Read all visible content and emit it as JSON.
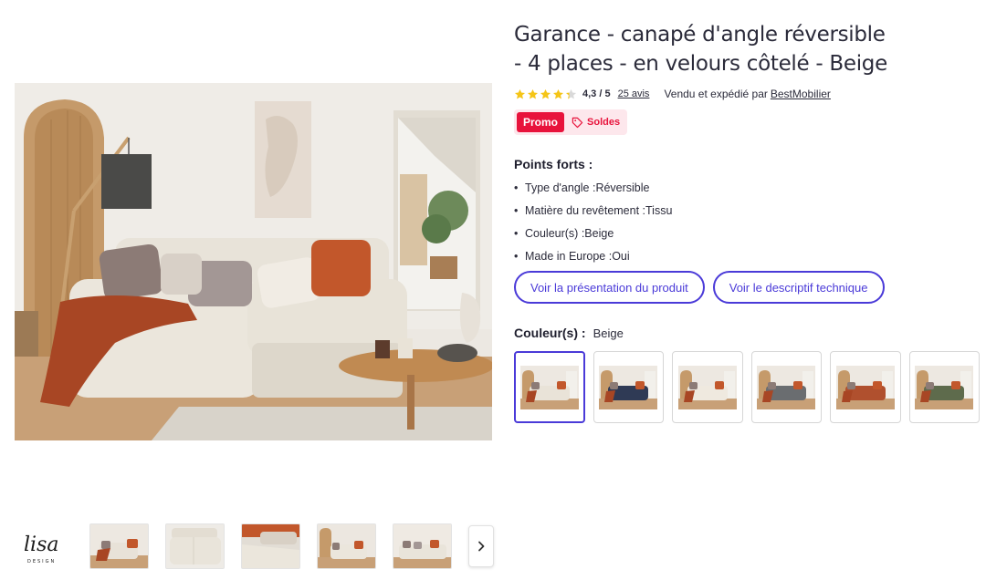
{
  "product": {
    "title_line1": "Garance - canapé d'angle réversible",
    "title_line2": "- 4 places - en velours côtelé - Beige",
    "rating": "4,3 / 5",
    "rating_stars": 4.3,
    "reviews": "25 avis",
    "seller_label": "Vendu et expédié par",
    "seller_name": "BestMobilier"
  },
  "badges": {
    "promo": "Promo",
    "soldes": "Soldes"
  },
  "highlights": {
    "heading": "Points forts :",
    "items": [
      "Type d'angle :Réversible",
      "Matière du revêtement :Tissu",
      "Couleur(s) :Beige",
      "Made in Europe :Oui"
    ]
  },
  "buttons": {
    "presentation": "Voir la présentation du produit",
    "technical": "Voir le descriptif technique"
  },
  "color": {
    "label": "Couleur(s) :",
    "value": "Beige",
    "swatches": [
      {
        "name": "Beige",
        "sofa": "#e9e3d8"
      },
      {
        "name": "Bleu",
        "sofa": "#2f3a55"
      },
      {
        "name": "Crème",
        "sofa": "#efe9df"
      },
      {
        "name": "Gris",
        "sofa": "#6a6d70"
      },
      {
        "name": "Terracotta",
        "sofa": "#b0502e"
      },
      {
        "name": "Vert",
        "sofa": "#5e6b4c"
      }
    ]
  },
  "gallery": {
    "brand_logo": "lisa",
    "brand_sub": "DESIGN",
    "thumbnail_count": 5
  },
  "colors": {
    "accent": "#4a3ad8",
    "promo": "#e8133c",
    "star": "#f5c518"
  },
  "icons": {
    "tag": "tag-icon",
    "next": "chevron-right-icon",
    "star": "star-icon"
  }
}
